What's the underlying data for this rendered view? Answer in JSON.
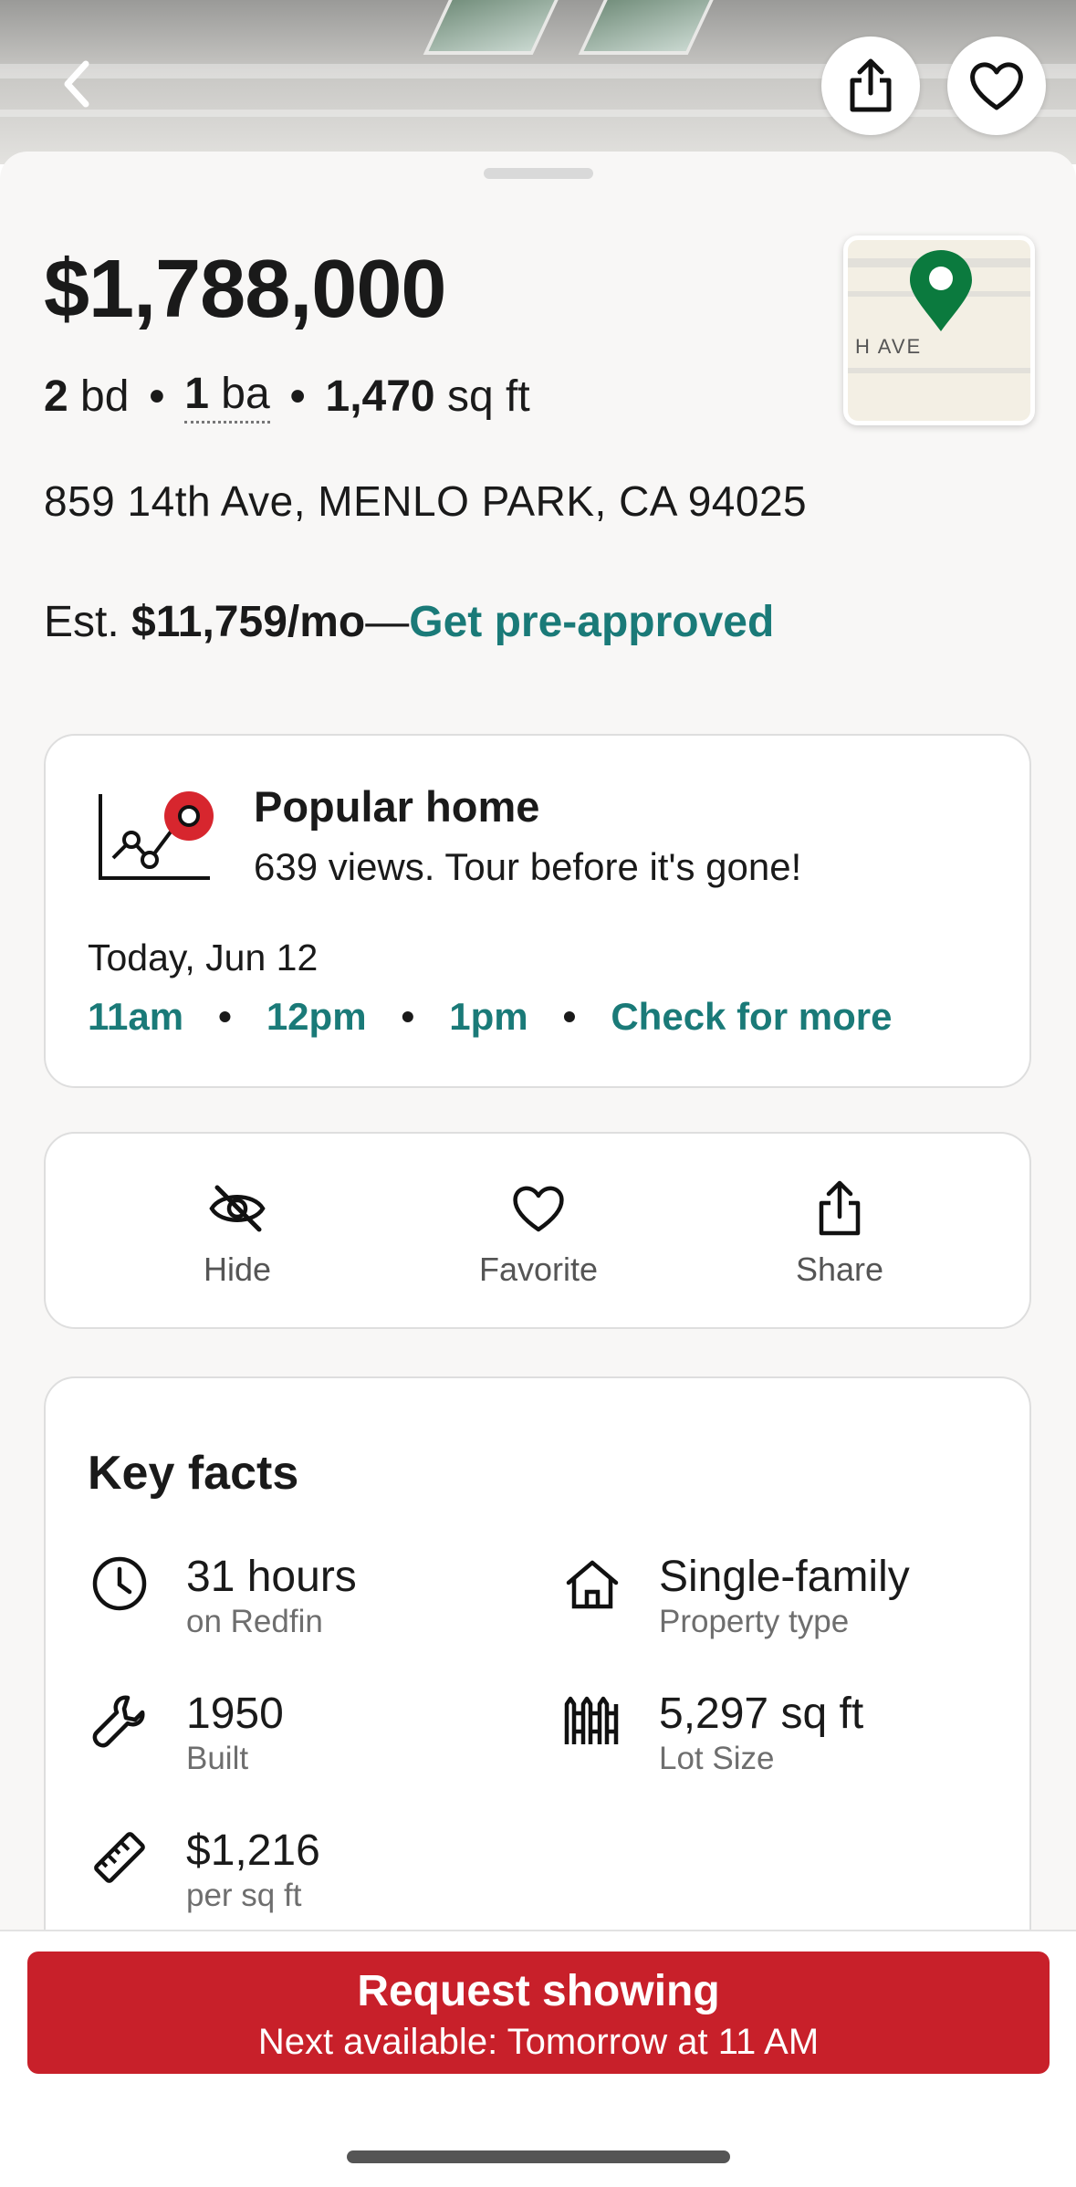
{
  "listing": {
    "price": "$1,788,000",
    "beds_value": "2",
    "beds_unit": "bd",
    "baths_value": "1",
    "baths_unit": "ba",
    "sqft_value": "1,470",
    "sqft_unit": "sq ft",
    "address": "859 14th Ave, MENLO PARK, CA 94025",
    "estimate_prefix": "Est.",
    "estimate_value": "$11,759/mo",
    "estimate_dash": "—",
    "preapproved_link": "Get pre-approved"
  },
  "map": {
    "road_label": "H AVE",
    "pin_color": "#0b7a3e"
  },
  "popular": {
    "title": "Popular home",
    "subtitle": "639 views. Tour before it's gone!",
    "date": "Today, Jun 12",
    "slots": [
      "11am",
      "12pm",
      "1pm"
    ],
    "more": "Check for more"
  },
  "actions": [
    {
      "label": "Hide",
      "icon": "eye-off-icon"
    },
    {
      "label": "Favorite",
      "icon": "heart-icon"
    },
    {
      "label": "Share",
      "icon": "share-icon"
    }
  ],
  "key_facts": {
    "title": "Key facts",
    "items": [
      {
        "value": "31 hours",
        "label": "on Redfin",
        "icon": "clock-icon"
      },
      {
        "value": "Single-family",
        "label": "Property type",
        "icon": "house-icon"
      },
      {
        "value": "1950",
        "label": "Built",
        "icon": "wrench-icon"
      },
      {
        "value": "5,297 sq ft",
        "label": "Lot Size",
        "icon": "fence-icon"
      },
      {
        "value": "$1,216",
        "label": "per sq ft",
        "icon": "ruler-icon"
      }
    ]
  },
  "cta": {
    "title": "Request showing",
    "subtitle": "Next available: Tomorrow at 11 AM",
    "color": "#c8202a"
  },
  "colors": {
    "accent": "#1a7a78",
    "popular_dot": "#d7262e"
  }
}
